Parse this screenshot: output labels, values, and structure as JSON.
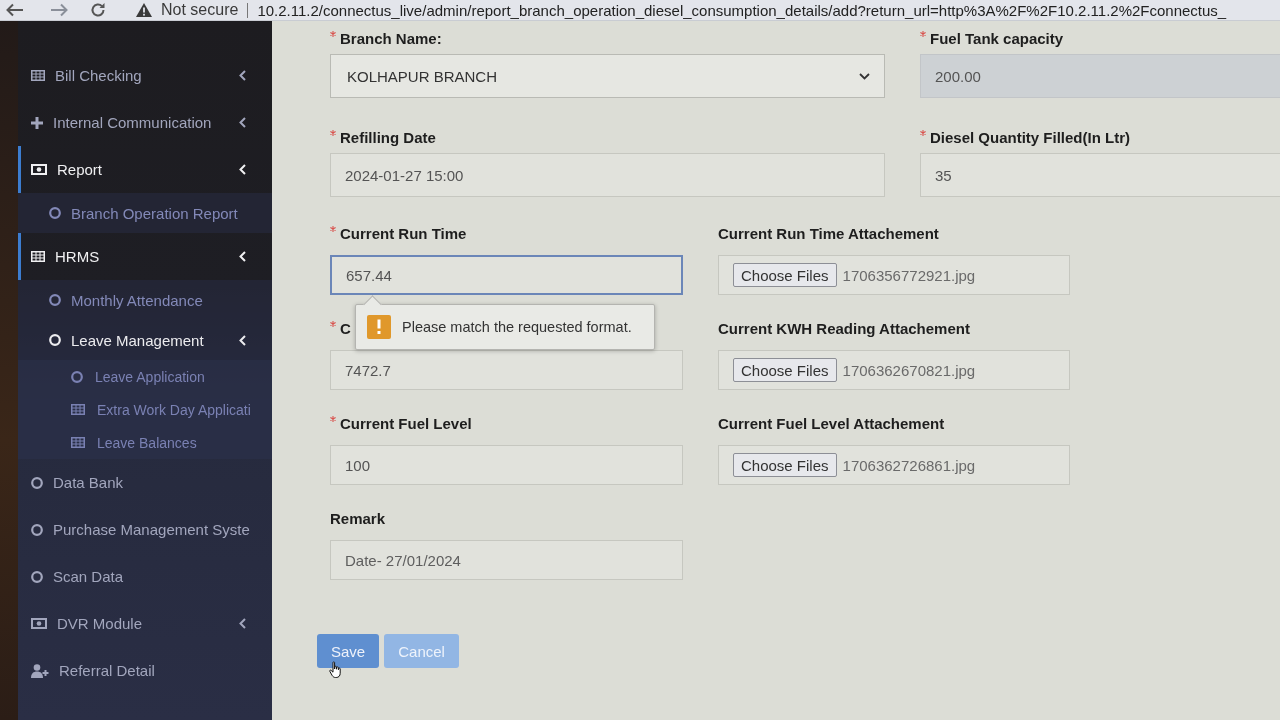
{
  "browser": {
    "security_label": "Not secure",
    "url": "10.2.11.2/connectus_live/admin/report_branch_operation_diesel_consumption_details/add?return_url=http%3A%2F%2F10.2.11.2%2Fconnectus_"
  },
  "sidebar": {
    "items": [
      {
        "label": "Bill Checking",
        "kind": "grid",
        "active": false,
        "chevron": true
      },
      {
        "label": "Internal Communication",
        "kind": "plus",
        "active": false,
        "chevron": true
      },
      {
        "label": "Report",
        "kind": "banknote",
        "active": true,
        "chevron": true,
        "children": [
          {
            "label": "Branch Operation Report",
            "kind": "circle",
            "active": false,
            "chevron": false
          }
        ]
      },
      {
        "label": "HRMS",
        "kind": "grid",
        "active": true,
        "chevron": true,
        "children": [
          {
            "label": "Monthly Attendance",
            "kind": "circle",
            "active": false,
            "chevron": false
          },
          {
            "label": "Leave Management",
            "kind": "circle",
            "active": true,
            "chevron": true,
            "children": [
              {
                "label": "Leave Application",
                "kind": "circle",
                "active": false,
                "chevron": false
              },
              {
                "label": "Extra Work Day Applicati",
                "kind": "grid",
                "active": false,
                "chevron": false
              },
              {
                "label": "Leave Balances",
                "kind": "grid",
                "active": false,
                "chevron": false
              }
            ]
          }
        ]
      },
      {
        "label": "Data Bank",
        "kind": "circle",
        "active": false,
        "chevron": false
      },
      {
        "label": "Purchase Management Syste",
        "kind": "circle",
        "active": false,
        "chevron": false
      },
      {
        "label": "Scan Data",
        "kind": "circle",
        "active": false,
        "chevron": false
      },
      {
        "label": "DVR Module",
        "kind": "banknote",
        "active": false,
        "chevron": true
      },
      {
        "label": "Referral Detail",
        "kind": "user-plus",
        "active": false,
        "chevron": false
      }
    ]
  },
  "form": {
    "groups": [
      {
        "rows": [
          {
            "fields": [
              {
                "kind": "select",
                "label": "Branch Name:",
                "required": true,
                "value": "KOLHAPUR BRANCH",
                "readonly": false,
                "focused": false
              },
              {
                "kind": "text",
                "label": "Fuel Tank capacity",
                "required": true,
                "value": "200.00",
                "readonly": true,
                "focused": false
              }
            ]
          },
          {
            "fields": [
              {
                "kind": "text",
                "label": "Refilling Date",
                "required": true,
                "value": "2024-01-27 15:00",
                "readonly": false,
                "focused": false
              },
              {
                "kind": "text",
                "label": "Diesel Quantity Filled(In Ltr)",
                "required": true,
                "value": "35",
                "readonly": false,
                "focused": false
              }
            ]
          }
        ]
      },
      {
        "rows": [
          {
            "fields": [
              {
                "kind": "text",
                "label": "Current Run Time",
                "required": true,
                "value": "657.44",
                "readonly": false,
                "focused": true,
                "validation_message": "Please match the requested format."
              },
              {
                "kind": "file",
                "label": "Current Run Time Attachement",
                "required": false,
                "button": "Choose Files",
                "file_name": "1706356772921.jpg",
                "readonly": false,
                "focused": false
              }
            ]
          },
          {
            "fields": [
              {
                "kind": "text",
                "label": "C",
                "required": true,
                "value": "7472.7",
                "readonly": false,
                "focused": false
              },
              {
                "kind": "file",
                "label": "Current KWH Reading Attachement",
                "required": false,
                "button": "Choose Files",
                "file_name": "1706362670821.jpg",
                "readonly": false,
                "focused": false
              }
            ]
          },
          {
            "fields": [
              {
                "kind": "text",
                "label": "Current Fuel Level",
                "required": true,
                "value": "100",
                "readonly": false,
                "focused": false
              },
              {
                "kind": "file",
                "label": "Current Fuel Level Attachement",
                "required": false,
                "button": "Choose Files",
                "file_name": "1706362726861.jpg",
                "readonly": false,
                "focused": false
              }
            ]
          },
          {
            "fields": [
              {
                "kind": "textarea",
                "label": "Remark",
                "required": false,
                "value": "Date- 27/01/2024",
                "readonly": false,
                "focused": false
              }
            ]
          }
        ]
      }
    ],
    "buttons": [
      {
        "label": "Save",
        "kind": "primary"
      },
      {
        "label": "Cancel",
        "kind": "secondary"
      }
    ]
  }
}
